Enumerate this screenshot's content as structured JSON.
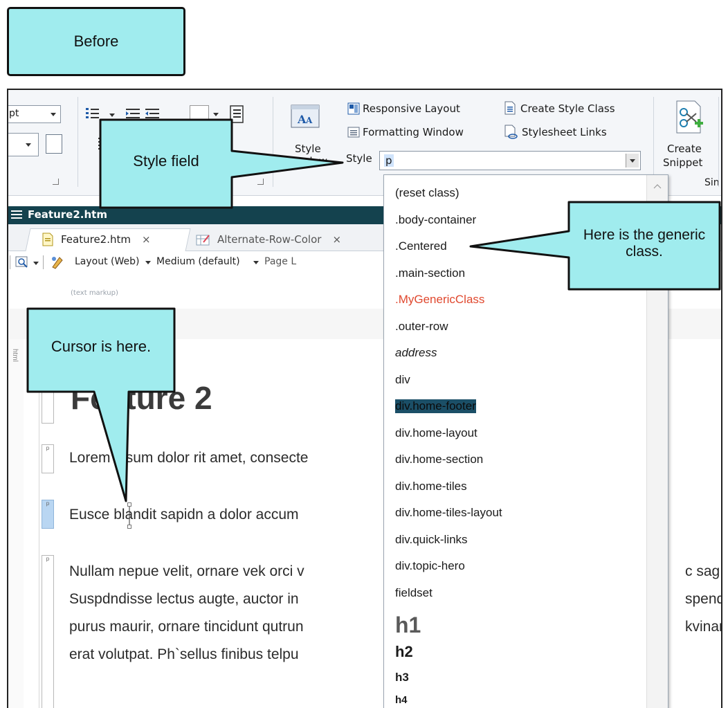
{
  "labels": {
    "before": "Before",
    "style_field_callout": "Style field",
    "generic_class_callout": "Here is the generic class.",
    "cursor_callout": "Cursor is here."
  },
  "ribbon": {
    "font_size_value": "pt",
    "responsive_layout": "Responsive Layout",
    "create_style_class": "Create Style Class",
    "formatting_window": "Formatting Window",
    "stylesheet_links": "Stylesheet Links",
    "style_window_line1": "Style",
    "style_window_line2": "dow",
    "style_label": "Style",
    "style_value": "p",
    "create_snippet_line1": "Create",
    "create_snippet_line2": "Snippet",
    "single_partial": "Sin"
  },
  "document": {
    "title": "Feature2.htm",
    "tabs": [
      {
        "label": "Feature2.htm",
        "close": "×"
      },
      {
        "label": "Alternate-Row-Color",
        "close": "×"
      }
    ],
    "toolbar": {
      "layout": "Layout (Web)",
      "medium": "Medium (default)",
      "page": "Page L"
    },
    "markup_label": "(text markup)",
    "gutter_label": "html",
    "heading": "Feature 2",
    "paragraphs": [
      "Lorem ipsum dolor rit amet, consecte",
      "Eusce blandit sapidn a dolor accum",
      "Nullam nepue velit, ornare vek orci v",
      "Suspdndisse lectus augte, auctor in",
      "purus maurir, ornare tincidunt qutrun",
      "erat volutpat. Ph`sellus finibus telpu"
    ],
    "right_fragments": [
      "c sag",
      "spend",
      "kvinar"
    ]
  },
  "dropdown": {
    "items": [
      {
        "label": "(reset class)",
        "style": "normal"
      },
      {
        "label": ".body-container",
        "style": "normal"
      },
      {
        "label": ".Centered",
        "style": "normal"
      },
      {
        "label": ".main-section",
        "style": "normal"
      },
      {
        "label": ".MyGenericClass",
        "style": "red"
      },
      {
        "label": ".outer-row",
        "style": "normal"
      },
      {
        "label": "address",
        "style": "italic"
      },
      {
        "label": "div",
        "style": "normal"
      },
      {
        "label": "div.home-footer",
        "style": "highlight"
      },
      {
        "label": "div.home-layout",
        "style": "normal"
      },
      {
        "label": "div.home-section",
        "style": "normal"
      },
      {
        "label": "div.home-tiles",
        "style": "normal"
      },
      {
        "label": "div.home-tiles-layout",
        "style": "normal"
      },
      {
        "label": "div.quick-links",
        "style": "normal"
      },
      {
        "label": "div.topic-hero",
        "style": "normal"
      },
      {
        "label": "fieldset",
        "style": "normal"
      },
      {
        "label": "h1",
        "style": "h1"
      },
      {
        "label": "h2",
        "style": "h2"
      },
      {
        "label": "h3",
        "style": "h3"
      },
      {
        "label": "h4",
        "style": "h4"
      }
    ]
  },
  "colors": {
    "callout_fill": "#a0ecee",
    "titlebar": "#14424e",
    "highlight_bg": "#1b4f67",
    "red_class": "#e0482e",
    "active_gutter": "#b9d6f2"
  }
}
